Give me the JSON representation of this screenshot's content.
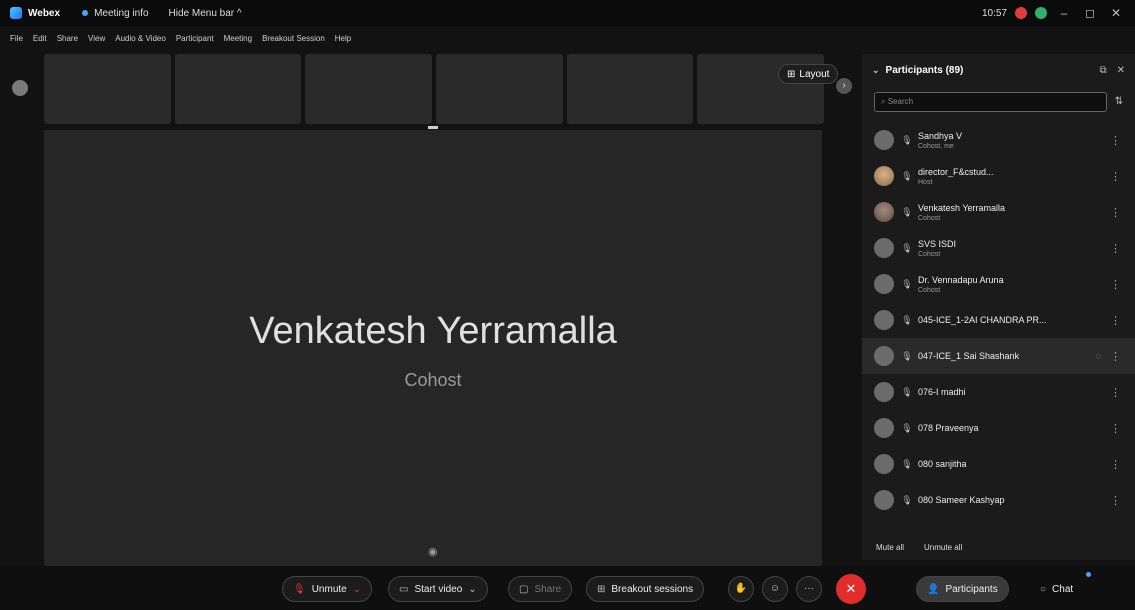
{
  "titlebar": {
    "app_name": "Webex",
    "meeting_title": "",
    "meeting_info": "Meeting info",
    "hide_menu": "Hide Menu bar ^",
    "time": "10:57"
  },
  "menu": [
    "File",
    "Edit",
    "Share",
    "View",
    "Audio & Video",
    "Participant",
    "Meeting",
    "Breakout Session",
    "Help"
  ],
  "thumbnails": [
    "",
    "",
    "",
    "",
    "",
    ""
  ],
  "layout_button": "Layout",
  "stage": {
    "speaker_name": "Venkatesh Yerramalla",
    "speaker_role": "Cohost"
  },
  "panel": {
    "title": "Participants (89)",
    "search_placeholder": "Search",
    "participants": [
      {
        "name": "Sandhya V",
        "role": "Cohost, me",
        "avatar": "initials"
      },
      {
        "name": "director_F&cstud...",
        "role": "Host",
        "avatar": "photo"
      },
      {
        "name": "Venkatesh Yerramalla",
        "role": "Cohost",
        "avatar": "photo2"
      },
      {
        "name": "SVS ISDI",
        "role": "Cohost",
        "avatar": "initials"
      },
      {
        "name": "Dr. Vennadapu Aruna",
        "role": "Cohost",
        "avatar": "initials"
      },
      {
        "name": "045-ICE_1-2AI CHANDRA PR...",
        "role": "",
        "avatar": "initials"
      },
      {
        "name": "047-ICE_1 Sai Shashank",
        "role": "",
        "avatar": "initials"
      },
      {
        "name": "076-I madhi",
        "role": "",
        "avatar": "initials"
      },
      {
        "name": "078 Praveenya",
        "role": "",
        "avatar": "initials"
      },
      {
        "name": "080 sanjitha",
        "role": "",
        "avatar": "initials"
      },
      {
        "name": "080 Sameer Kashyap",
        "role": "",
        "avatar": "initials"
      }
    ],
    "mute_all": "Mute all",
    "unmute_all": "Unmute all"
  },
  "bottombar": {
    "unmute": "Unmute",
    "start_video": "Start video",
    "share": "Share",
    "breakout": "Breakout sessions",
    "participants": "Participants",
    "chat": "Chat"
  },
  "colors": {
    "end_call": "#e22d2d",
    "accent": "#4aa3ff"
  }
}
